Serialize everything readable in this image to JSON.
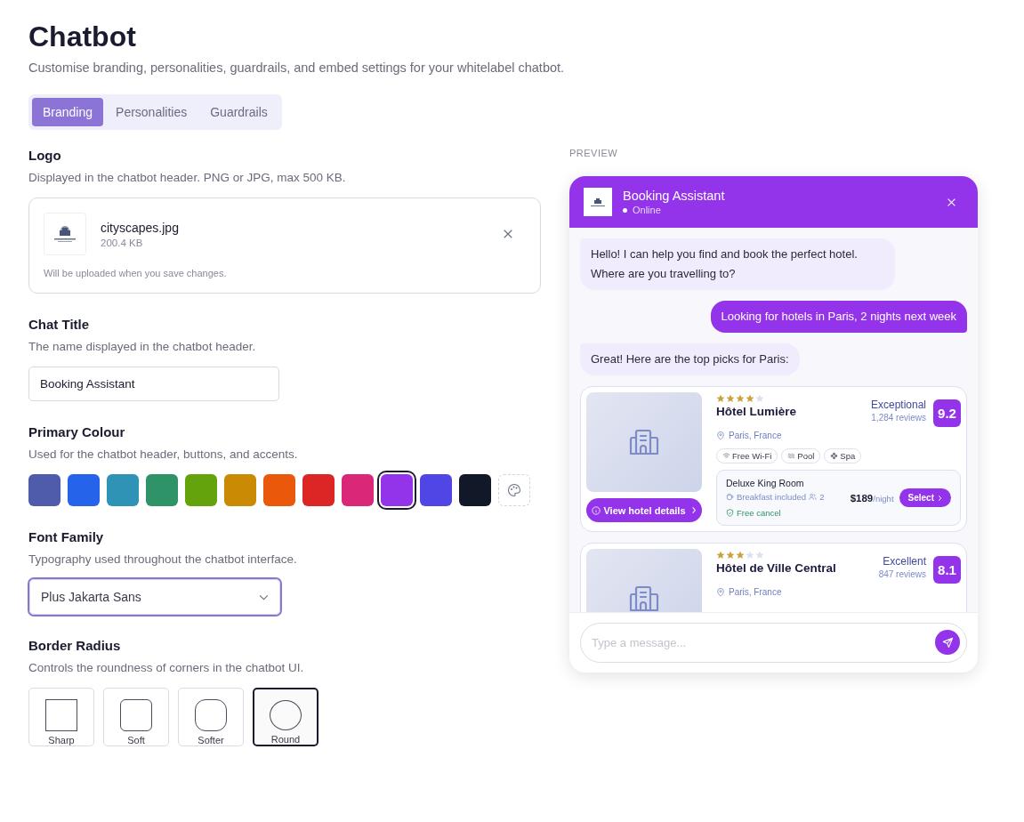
{
  "page": {
    "title": "Chatbot",
    "subtitle": "Customise branding, personalities, guardrails, and embed settings for your whitelabel chatbot."
  },
  "tabs": [
    {
      "label": "Branding",
      "selected": true
    },
    {
      "label": "Personalities",
      "selected": false
    },
    {
      "label": "Guardrails",
      "selected": false
    }
  ],
  "logo": {
    "heading": "Logo",
    "description": "Displayed in the chatbot header. PNG or JPG, max 500 KB.",
    "file_name": "cityscapes.jpg",
    "file_size": "200.4 KB",
    "note": "Will be uploaded when you save changes."
  },
  "chat_title": {
    "heading": "Chat Title",
    "description": "The name displayed in the chatbot header.",
    "value": "Booking Assistant"
  },
  "primary_colour": {
    "heading": "Primary Colour",
    "description": "Used for the chatbot header, buttons, and accents.",
    "swatches": [
      {
        "color": "#4f5bab",
        "selected": false
      },
      {
        "color": "#2563eb",
        "selected": false
      },
      {
        "color": "#2e93b5",
        "selected": false
      },
      {
        "color": "#2e9467",
        "selected": false
      },
      {
        "color": "#65a30d",
        "selected": false
      },
      {
        "color": "#ca8a04",
        "selected": false
      },
      {
        "color": "#ea580c",
        "selected": false
      },
      {
        "color": "#dc2626",
        "selected": false
      },
      {
        "color": "#db2777",
        "selected": false
      },
      {
        "color": "#9333ea",
        "selected": true
      },
      {
        "color": "#4f46e5",
        "selected": false
      },
      {
        "color": "#111827",
        "selected": false
      }
    ]
  },
  "font_family": {
    "heading": "Font Family",
    "description": "Typography used throughout the chatbot interface.",
    "value": "Plus Jakarta Sans"
  },
  "border_radius": {
    "heading": "Border Radius",
    "description": "Controls the roundness of corners in the chatbot UI.",
    "options": [
      {
        "label": "Sharp",
        "kind": "sharp",
        "selected": false
      },
      {
        "label": "Soft",
        "kind": "soft",
        "selected": false
      },
      {
        "label": "Softer",
        "kind": "softer",
        "selected": false
      },
      {
        "label": "Round",
        "kind": "round",
        "selected": true
      }
    ]
  },
  "preview": {
    "label": "PREVIEW",
    "title": "Booking Assistant",
    "status": "Online",
    "messages": [
      {
        "kind": "bot",
        "text": "Hello! I can help you find and book the perfect hotel. Where are you travelling to?"
      },
      {
        "kind": "user",
        "text": "Looking for hotels in Paris, 2 nights next week"
      },
      {
        "kind": "bot",
        "text": "Great! Here are the top picks for Paris:"
      }
    ],
    "hotels": [
      {
        "stars": 4,
        "name": "Hôtel Lumière",
        "rating_label": "Exceptional",
        "reviews": "1,284 reviews",
        "score": "9.2",
        "location": "Paris, France",
        "amenities": [
          {
            "kind": "wifi",
            "label": "Free Wi-Fi"
          },
          {
            "kind": "pool",
            "label": "Pool"
          },
          {
            "kind": "spa",
            "label": "Spa"
          }
        ],
        "details_button": "View hotel details",
        "room": {
          "name": "Deluxe King Room",
          "breakfast": "Breakfast included",
          "guests": "2",
          "cancel": "Free cancel",
          "price": "$189",
          "per": "/night",
          "select": "Select"
        }
      },
      {
        "stars": 3,
        "name": "Hôtel de Ville Central",
        "rating_label": "Excellent",
        "reviews": "847 reviews",
        "score": "8.1",
        "location": "Paris, France"
      }
    ],
    "placeholder": "Type a message..."
  }
}
